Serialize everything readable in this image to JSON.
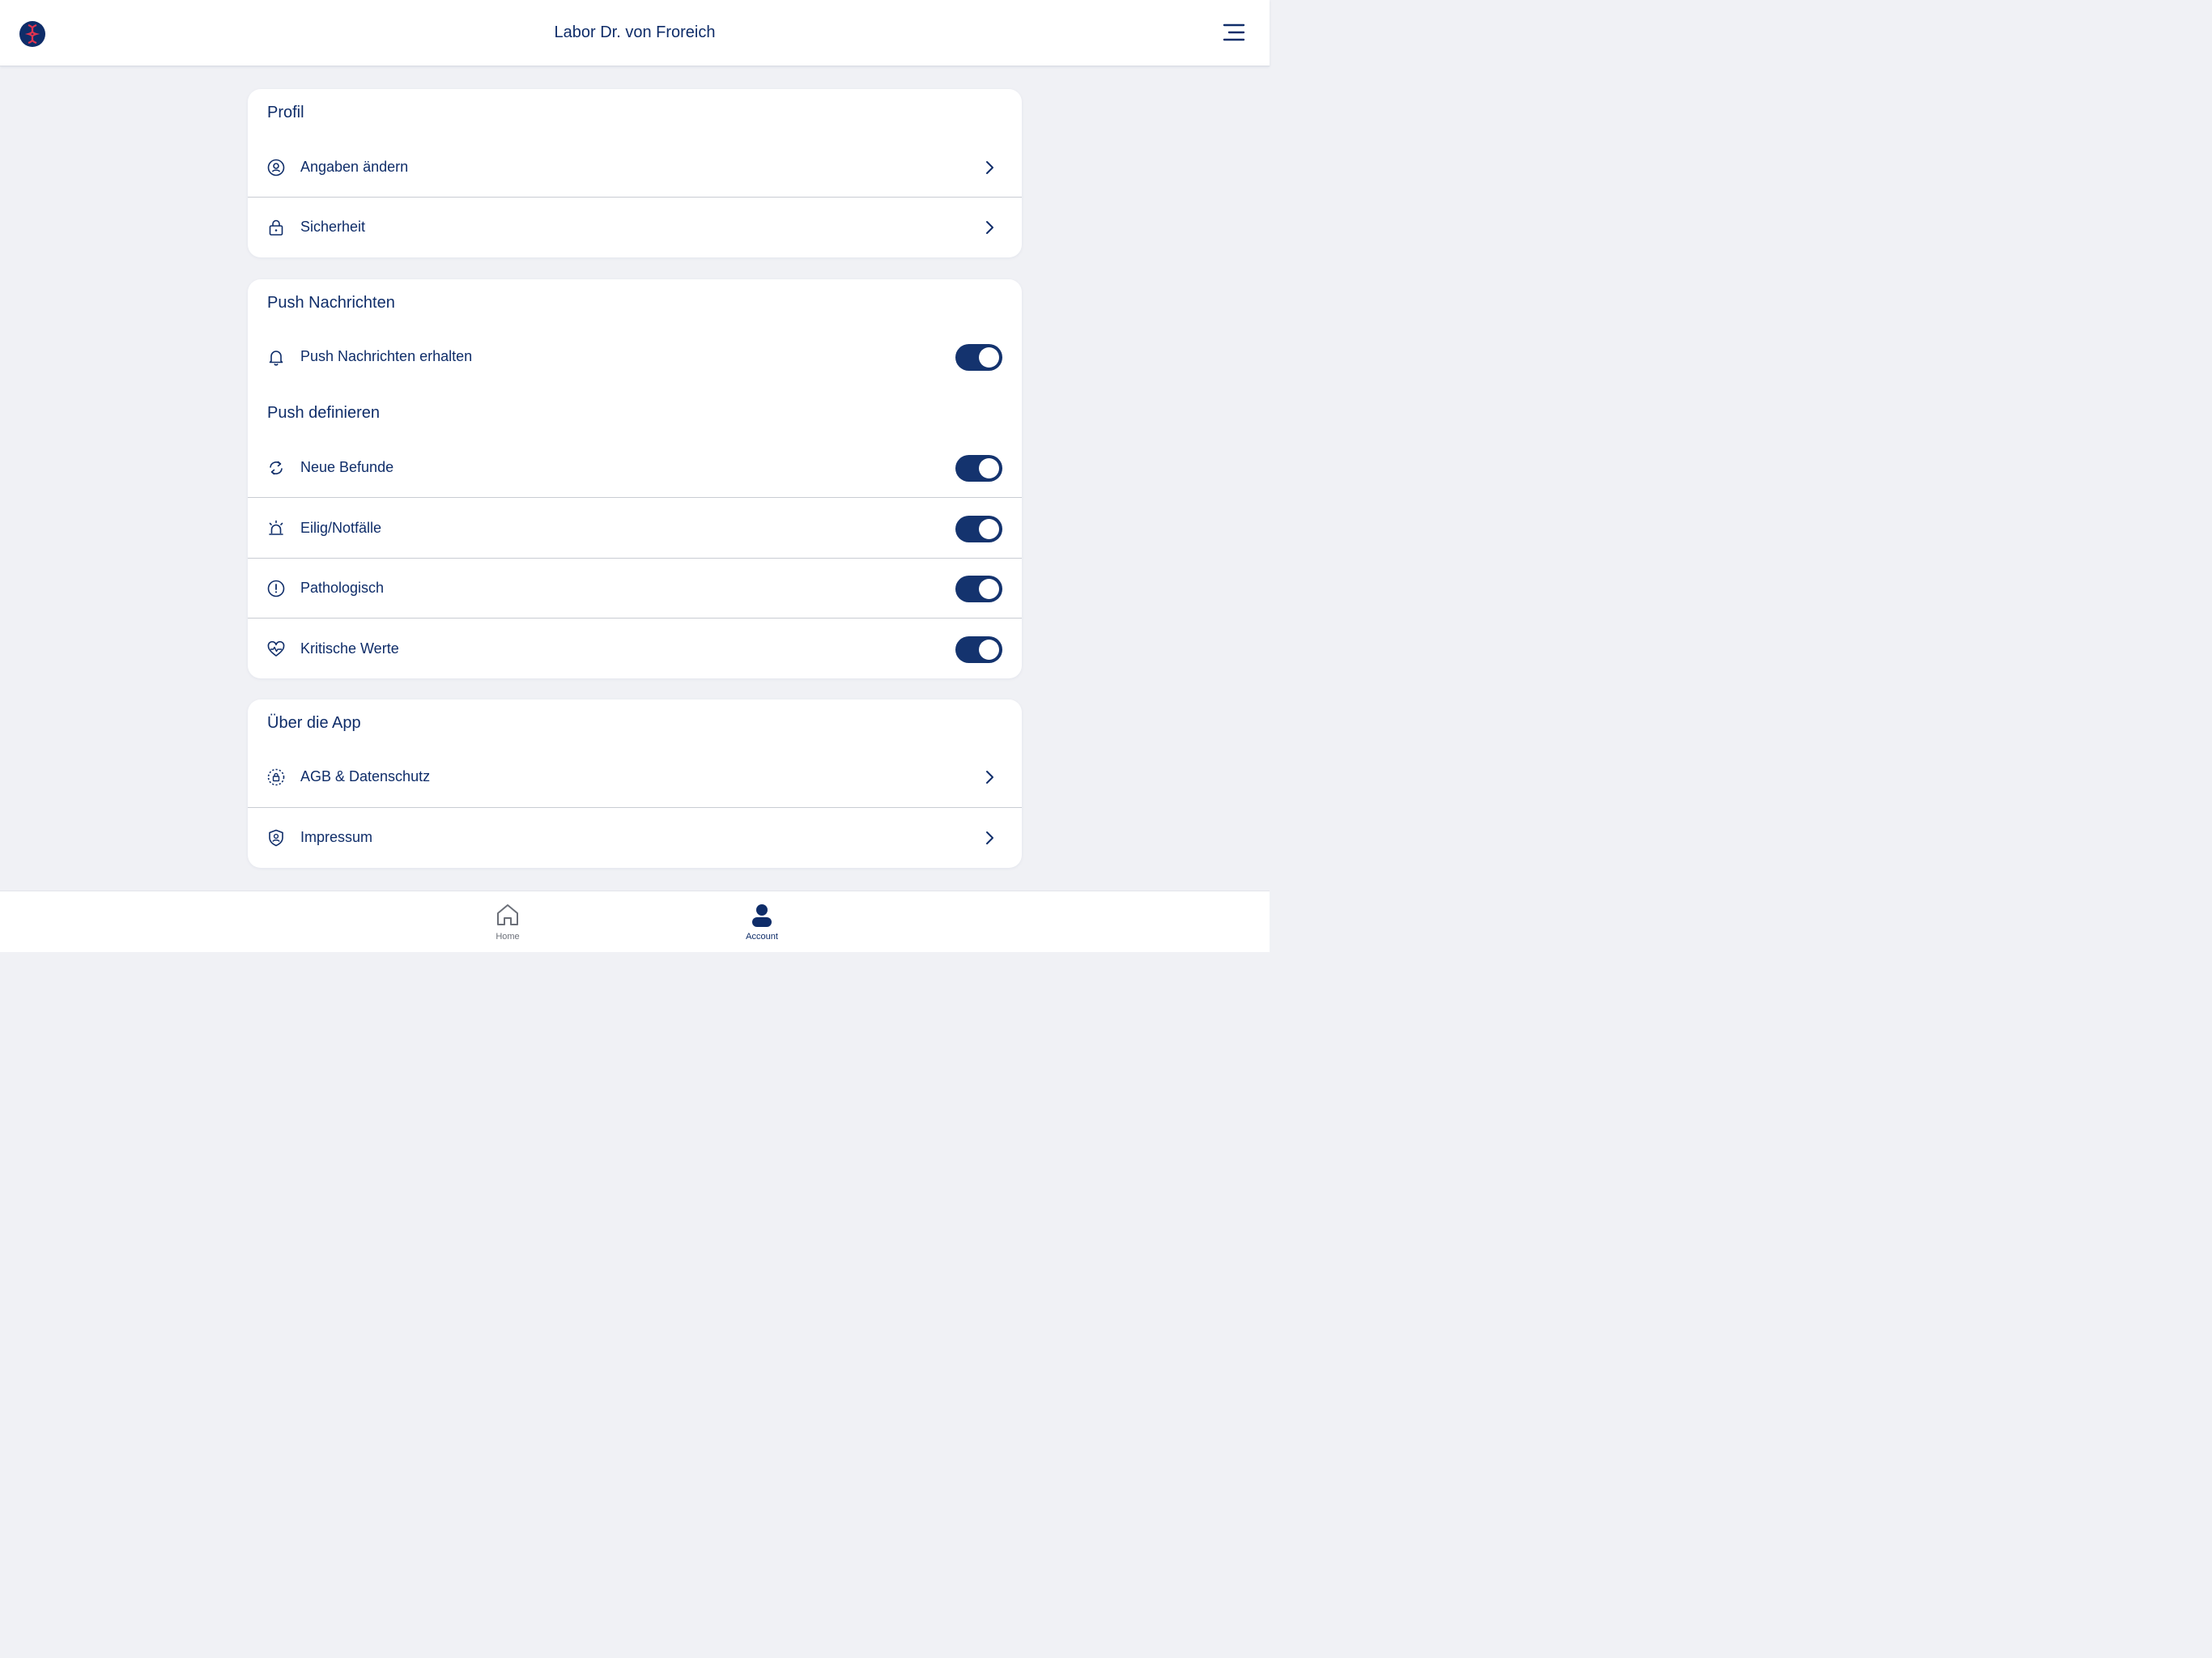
{
  "header": {
    "title": "Labor Dr. von Froreich",
    "logo_icon": "lab-logo-icon",
    "menu_icon": "menu-icon"
  },
  "profil": {
    "title": "Profil",
    "items": [
      {
        "label": "Angaben ändern",
        "icon": "user-circle-icon"
      },
      {
        "label": "Sicherheit",
        "icon": "lock-icon"
      }
    ]
  },
  "push": {
    "title": "Push Nachrichten",
    "receive": {
      "label": "Push Nachrichten erhalten",
      "icon": "bell-icon",
      "on": true
    },
    "define_title": "Push definieren",
    "items": [
      {
        "label": "Neue Befunde",
        "icon": "refresh-icon",
        "on": true
      },
      {
        "label": "Eilig/Notfälle",
        "icon": "siren-icon",
        "on": true
      },
      {
        "label": "Pathologisch",
        "icon": "alert-circle-icon",
        "on": true
      },
      {
        "label": "Kritische Werte",
        "icon": "heart-pulse-icon",
        "on": true
      }
    ]
  },
  "about": {
    "title": "Über die App",
    "items": [
      {
        "label": "AGB & Datenschutz",
        "icon": "privacy-lock-icon"
      },
      {
        "label": "Impressum",
        "icon": "shield-user-icon"
      }
    ]
  },
  "tabbar": {
    "tabs": [
      {
        "label": "Home",
        "icon": "home-icon",
        "active": false
      },
      {
        "label": "Account",
        "icon": "user-icon",
        "active": true
      }
    ]
  },
  "colors": {
    "primary": "#0f2d69",
    "toggle_on": "#14336e",
    "background": "#f0f1f5",
    "logo_red": "#e0334f",
    "tab_inactive": "#6b6f78"
  }
}
